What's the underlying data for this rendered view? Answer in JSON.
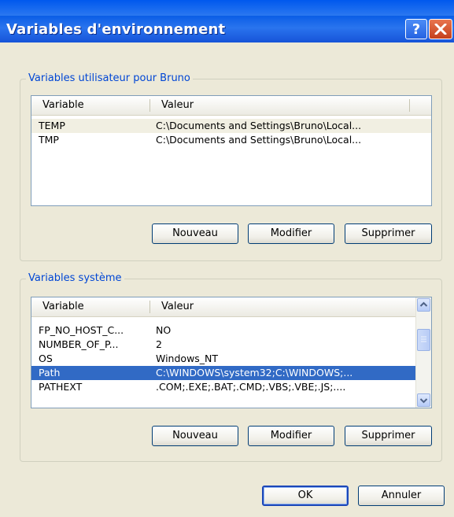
{
  "window": {
    "title": "Variables d'environnement"
  },
  "user_group": {
    "label": "Variables utilisateur pour Bruno",
    "columns": [
      "Variable",
      "Valeur"
    ],
    "rows": [
      {
        "name": "TEMP",
        "value": "C:\\Documents and Settings\\Bruno\\Local..."
      },
      {
        "name": "TMP",
        "value": "C:\\Documents and Settings\\Bruno\\Local..."
      }
    ],
    "buttons": {
      "new": "Nouveau",
      "edit": "Modifier",
      "delete": "Supprimer"
    }
  },
  "system_group": {
    "label": "Variables système",
    "columns": [
      "Variable",
      "Valeur"
    ],
    "rows": [
      {
        "name": "FP_NO_HOST_C...",
        "value": "NO"
      },
      {
        "name": "NUMBER_OF_P...",
        "value": "2"
      },
      {
        "name": "OS",
        "value": "Windows_NT"
      },
      {
        "name": "Path",
        "value": "C:\\WINDOWS\\system32;C:\\WINDOWS;..."
      },
      {
        "name": "PATHEXT",
        "value": ".COM;.EXE;.BAT;.CMD;.VBS;.VBE;.JS;...."
      }
    ],
    "selected_row": "Path",
    "buttons": {
      "new": "Nouveau",
      "edit": "Modifier",
      "delete": "Supprimer"
    }
  },
  "footer": {
    "ok": "OK",
    "cancel": "Annuler"
  },
  "icons": {
    "help": "help-icon",
    "close": "close-icon",
    "scroll_up": "chevron-up-icon",
    "scroll_down": "chevron-down-icon"
  },
  "colors": {
    "title_bar": "#0a5de6",
    "close_button": "#c4401c",
    "group_label": "#0046d5",
    "selection": "#316ac5"
  },
  "help_glyph": "?"
}
